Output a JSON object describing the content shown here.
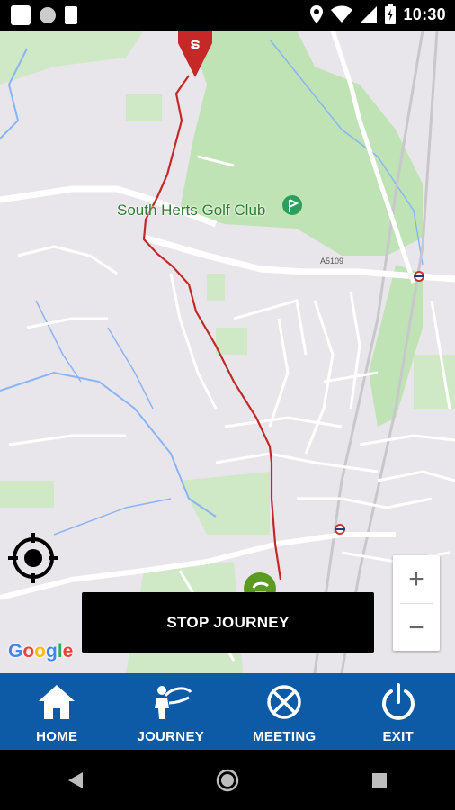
{
  "status_bar": {
    "time": "10:30",
    "icons": [
      "notification-square-icon",
      "record-icon",
      "sim-card-icon",
      "location-icon",
      "wifi-icon",
      "signal-icon",
      "battery-icon"
    ]
  },
  "map": {
    "place_label": "South Herts Golf Club",
    "road_label": "A5109",
    "google_logo": {
      "letters": [
        "G",
        "o",
        "o",
        "g",
        "l",
        "e"
      ],
      "colors": [
        "#4285F4",
        "#EA4335",
        "#FBBC05",
        "#4285F4",
        "#34A853",
        "#EA4335"
      ]
    },
    "zoom_in_label": "+",
    "zoom_out_label": "−",
    "route_color": "#c62828",
    "park_color": "#bfe3b4"
  },
  "actions": {
    "stop_journey_label": "STOP JOURNEY"
  },
  "bottom_nav": {
    "items": [
      {
        "label": "HOME",
        "icon": "home-icon"
      },
      {
        "label": "JOURNEY",
        "icon": "journey-icon"
      },
      {
        "label": "MEETING",
        "icon": "meeting-icon"
      },
      {
        "label": "EXIT",
        "icon": "power-icon"
      }
    ],
    "background": "#0d5aa7"
  },
  "system_nav": {
    "buttons": [
      "back-icon",
      "home-circle-icon",
      "recents-icon"
    ]
  }
}
